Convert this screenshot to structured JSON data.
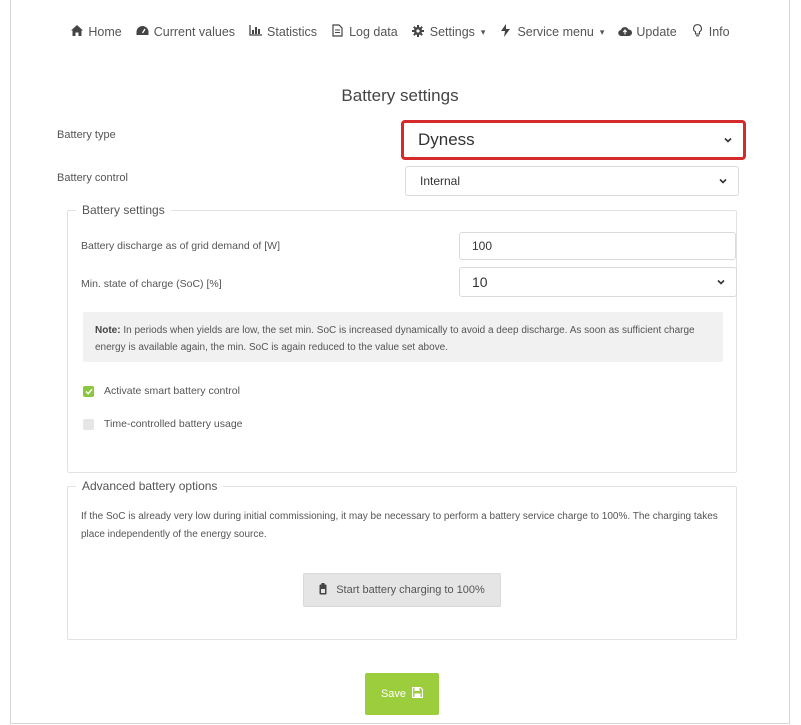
{
  "nav": {
    "items": [
      {
        "label": "Home",
        "icon": "home-icon"
      },
      {
        "label": "Current values",
        "icon": "dashboard-icon"
      },
      {
        "label": "Statistics",
        "icon": "bar-chart-icon"
      },
      {
        "label": "Log data",
        "icon": "document-icon"
      },
      {
        "label": "Settings",
        "icon": "gear-icon",
        "dropdown": true
      },
      {
        "label": "Service menu",
        "icon": "bolt-icon",
        "dropdown": true
      },
      {
        "label": "Update",
        "icon": "cloud-icon"
      },
      {
        "label": "Info",
        "icon": "lightbulb-icon"
      }
    ]
  },
  "page": {
    "title": "Battery settings"
  },
  "battery_type": {
    "label": "Battery type",
    "value": "Dyness"
  },
  "battery_control": {
    "label": "Battery control",
    "value": "Internal"
  },
  "battery_settings": {
    "legend": "Battery settings",
    "discharge": {
      "label": "Battery discharge as of grid demand of [W]",
      "value": "100"
    },
    "min_soc": {
      "label": "Min. state of charge (SoC) [%]",
      "value": "10"
    },
    "note": {
      "title": "Note:",
      "text": "In periods when yields are low, the set min. SoC is increased dynamically to avoid a deep discharge. As soon as sufficient charge energy is available again, the min. SoC is again reduced to the value set above."
    },
    "smart_control": {
      "label": "Activate smart battery control",
      "checked": true
    },
    "time_controlled": {
      "label": "Time-controlled battery usage",
      "checked": false
    }
  },
  "advanced": {
    "legend": "Advanced battery options",
    "text": "If the SoC is already very low during initial commissioning, it may be necessary to perform a battery service charge to 100%. The charging takes place independently of the energy source.",
    "charge_button": "Start battery charging to 100%"
  },
  "save_button": "Save",
  "colors": {
    "highlight": "#d32b2b",
    "accent": "#9ccd3c",
    "checkbox_on": "#8cc63f"
  }
}
